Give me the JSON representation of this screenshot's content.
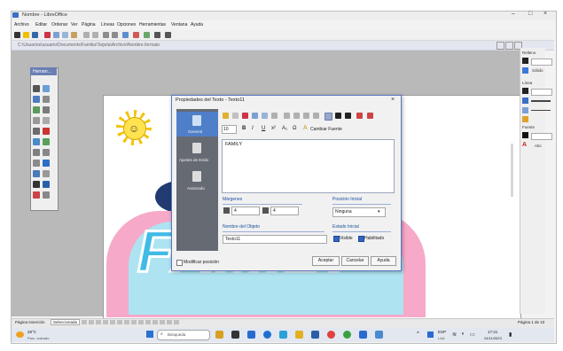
{
  "window": {
    "title": "Nombre - LibreOffice",
    "controls": [
      "–",
      "□",
      "×"
    ]
  },
  "menu": [
    "Archivo",
    "Editar",
    "Ordenar",
    "Ver",
    "Página",
    "Líneas",
    "Opciones",
    "Herramientas",
    "Ventana",
    "Ayuda"
  ],
  "pathbar": {
    "text": "C:\\Usuarios\\usuario\\Documents\\Familia\\Tarjeta\\Archivo\\Nombre.formato"
  },
  "toolbox": {
    "title": "Herram..."
  },
  "dialog": {
    "title": "Propiedades del Texto - Texto11",
    "close": "×",
    "nav": [
      {
        "label": "General"
      },
      {
        "label": "Ajustes de Estilo"
      },
      {
        "label": "Avanzado"
      }
    ],
    "format": {
      "size": "10",
      "bold": "B",
      "italic": "I",
      "underline": "U",
      "font_button": "Cambiar Fuente"
    },
    "text_value": "FAMILY",
    "sections": {
      "margins": "Márgenes",
      "position": "Posición Inicial",
      "object_name": "Nombre del Objeto",
      "initial_state": "Estado Inicial"
    },
    "margin_values": {
      "left": "4",
      "top": "4"
    },
    "position_value": "Ninguna",
    "object_name_value": "Texto11",
    "checkboxes": {
      "visible": "Visible",
      "enabled": "Habilitado"
    },
    "modify_position": "Modificar posición",
    "buttons": {
      "accept": "Aceptar",
      "cancel": "Cancelar",
      "help": "Ayuda"
    }
  },
  "right_panel": {
    "fill": "Relleno",
    "solid": "Sólido",
    "line": "Línea",
    "font": "Fuente",
    "font_value": "Abc"
  },
  "status": {
    "page_tab": "Página Inserción",
    "page_tab2": "Seleccionada",
    "page_info": "Página 1 de 10"
  },
  "taskbar": {
    "weather": "28°C",
    "weather_desc": "Parc. soleado",
    "search": "Búsqueda",
    "lang": "ESP",
    "lang2": "LAA",
    "time": "17:41",
    "date": "24/11/2023"
  }
}
